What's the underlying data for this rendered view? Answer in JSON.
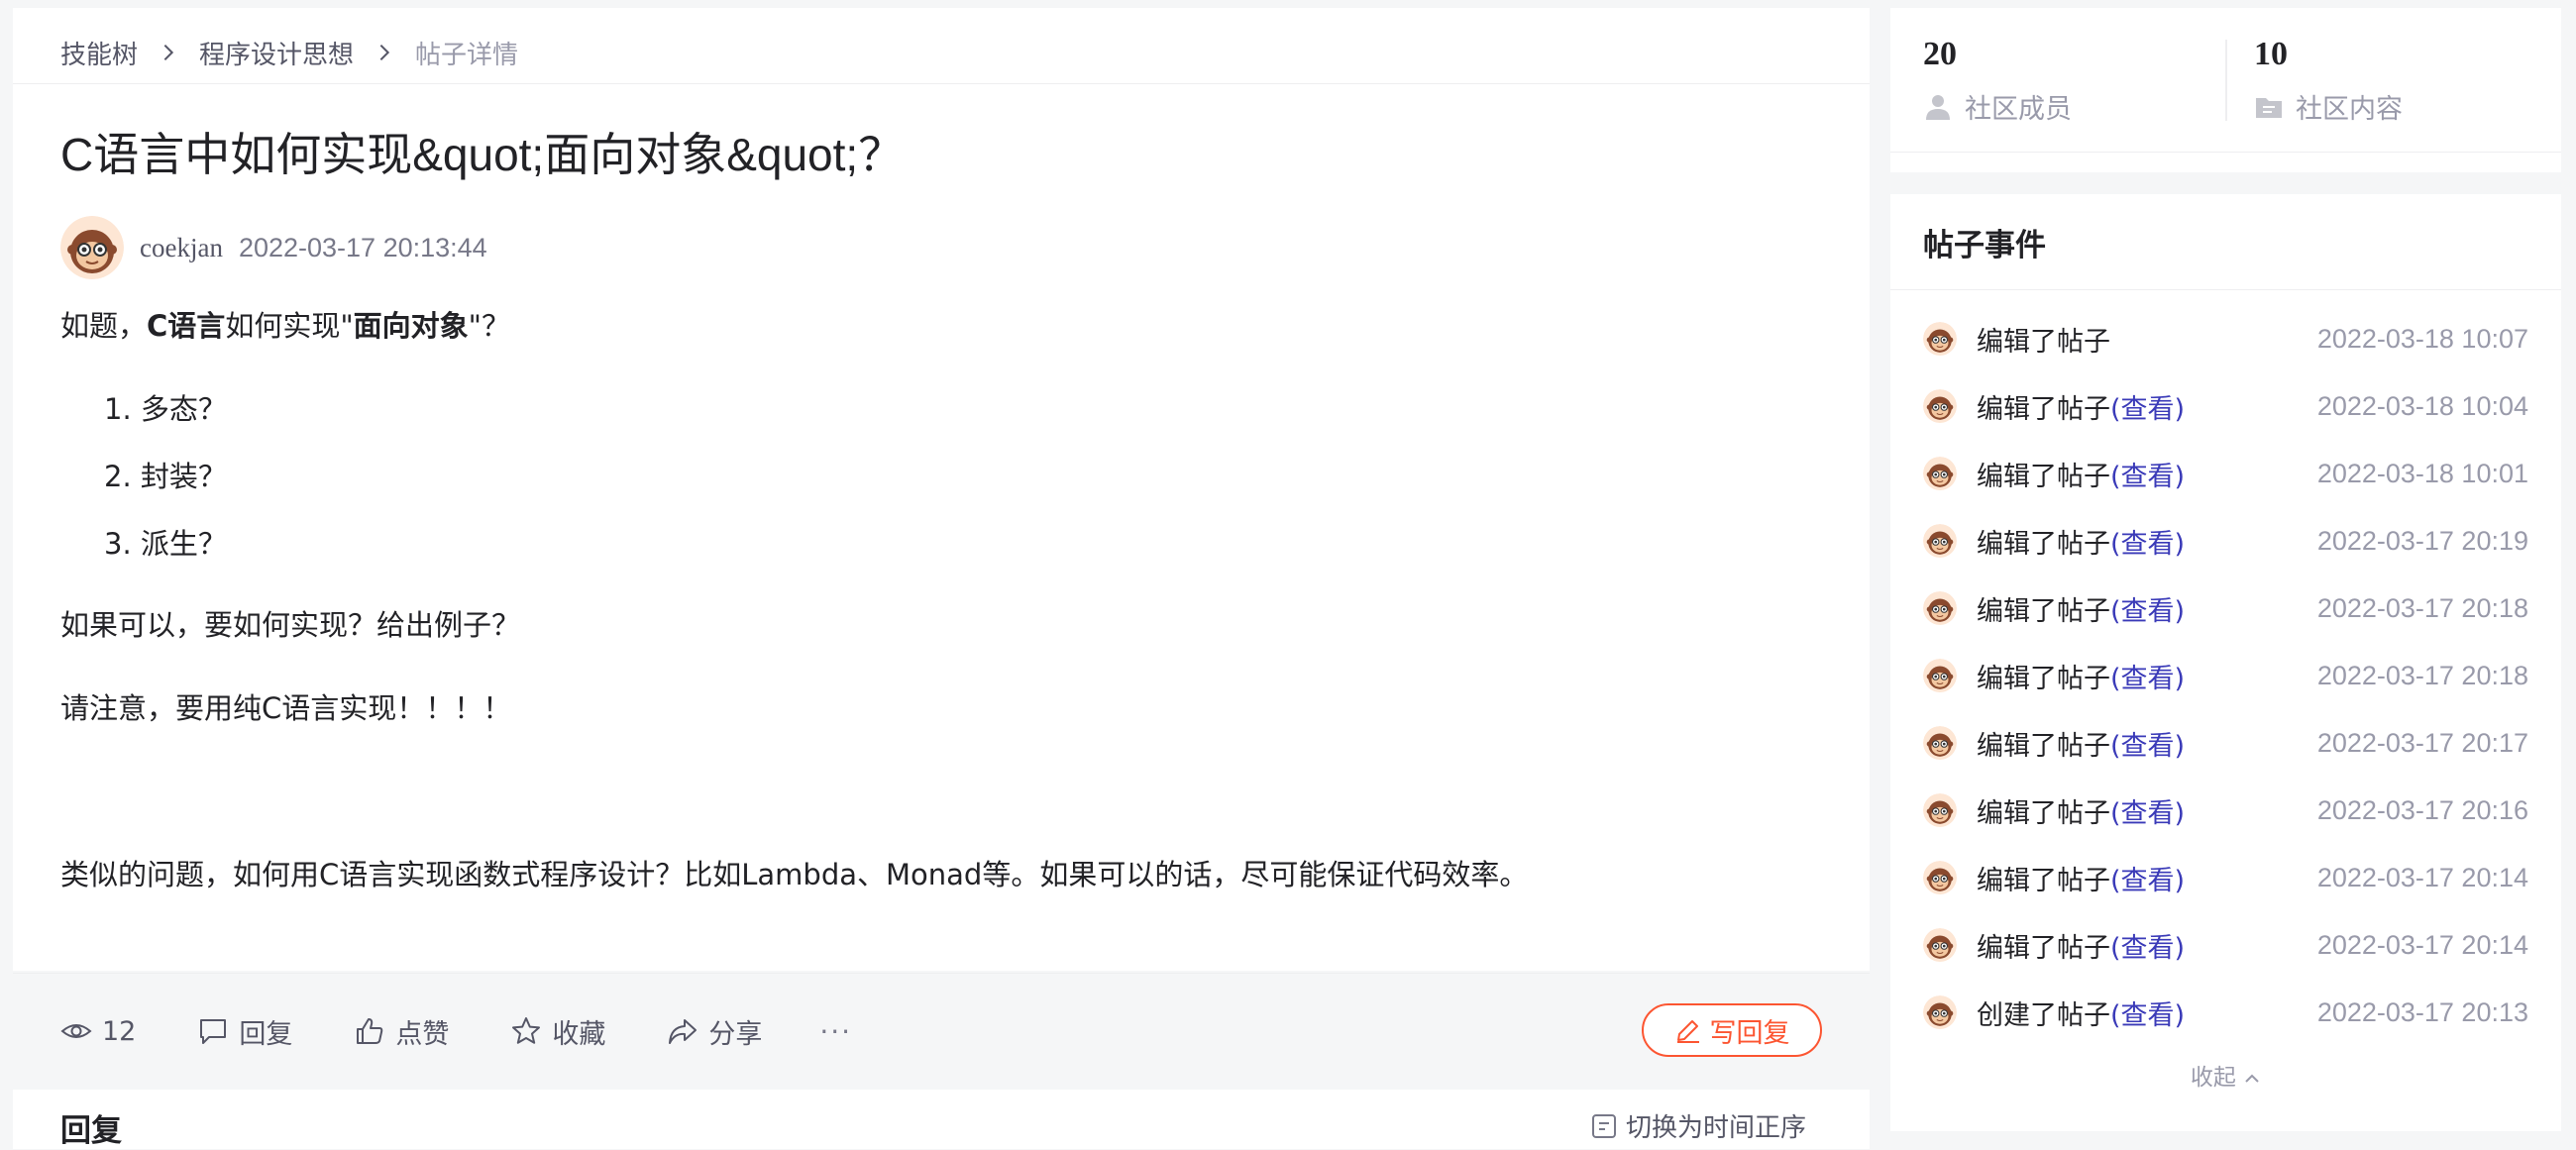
{
  "breadcrumb": {
    "items": [
      "技能树",
      "程序设计思想"
    ],
    "current": "帖子详情"
  },
  "post": {
    "title": "C语言中如何实现&quot;面向对象&quot;？",
    "author": "coekjan",
    "time": "2022-03-17 20:13:44",
    "intro": {
      "prefix": "如题，",
      "bold1": "C语言",
      "mid": "如何实现\"",
      "bold2": "面向对象",
      "suffix": "\"？"
    },
    "list": [
      "1. 多态？",
      "2. 封装？",
      "3. 派生？"
    ],
    "para1": "如果可以，要如何实现？给出例子？",
    "para2": "请注意，要用纯C语言实现！！！！",
    "para3": "类似的问题，如何用C语言实现函数式程序设计？比如Lambda、Monad等。如果可以的话，尽可能保证代码效率。"
  },
  "actions": {
    "views": "12",
    "reply": "回复",
    "like": "点赞",
    "favorite": "收藏",
    "share": "分享",
    "more": "···",
    "write_reply": "写回复"
  },
  "replies": {
    "title": "回复",
    "sort_label": "切换为时间正序"
  },
  "stats": {
    "members_count": "20",
    "members_label": "社区成员",
    "content_count": "10",
    "content_label": "社区内容"
  },
  "events": {
    "title": "帖子事件",
    "items": [
      {
        "text": "编辑了帖子",
        "link": "",
        "time": "2022-03-18 10:07"
      },
      {
        "text": "编辑了帖子",
        "link": "(查看)",
        "time": "2022-03-18 10:04"
      },
      {
        "text": "编辑了帖子",
        "link": "(查看)",
        "time": "2022-03-18 10:01"
      },
      {
        "text": "编辑了帖子",
        "link": "(查看)",
        "time": "2022-03-17 20:19"
      },
      {
        "text": "编辑了帖子",
        "link": "(查看)",
        "time": "2022-03-17 20:18"
      },
      {
        "text": "编辑了帖子",
        "link": "(查看)",
        "time": "2022-03-17 20:18"
      },
      {
        "text": "编辑了帖子",
        "link": "(查看)",
        "time": "2022-03-17 20:17"
      },
      {
        "text": "编辑了帖子",
        "link": "(查看)",
        "time": "2022-03-17 20:16"
      },
      {
        "text": "编辑了帖子",
        "link": "(查看)",
        "time": "2022-03-17 20:14"
      },
      {
        "text": "编辑了帖子",
        "link": "(查看)",
        "time": "2022-03-17 20:14"
      },
      {
        "text": "创建了帖子",
        "link": "(查看)",
        "time": "2022-03-17 20:13"
      }
    ],
    "collapse_label": "收起"
  },
  "colors": {
    "accent": "#fc5531",
    "link": "#3a3ab8",
    "muted": "#999aaa",
    "text": "#222226"
  },
  "icons": [
    "chevron-right-icon",
    "eye-icon",
    "comment-icon",
    "thumb-up-icon",
    "star-icon",
    "share-icon",
    "pen-icon",
    "sort-icon",
    "user-icon",
    "folder-icon",
    "avatar-monkey"
  ]
}
